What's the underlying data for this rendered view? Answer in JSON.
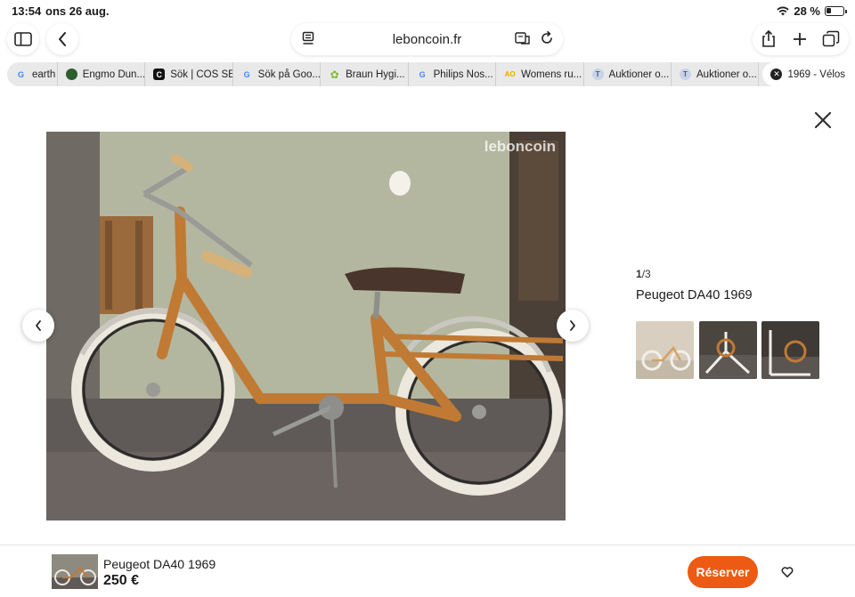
{
  "status": {
    "time": "13:54",
    "date": "ons 26 aug.",
    "battery": "28 %",
    "battery_level": 0.28
  },
  "toolbar": {
    "url": "leboncoin.fr"
  },
  "tabs": [
    {
      "label": "earth",
      "icon": "google-icon"
    },
    {
      "label": "Engmo Dun...",
      "icon": "globe-icon"
    },
    {
      "label": "Sök | COS SE",
      "icon": "cos-icon"
    },
    {
      "label": "Sök på Goo...",
      "icon": "google-icon"
    },
    {
      "label": "Braun Hygi...",
      "icon": "leaf-icon"
    },
    {
      "label": "Philips Nos...",
      "icon": "google-icon"
    },
    {
      "label": "Womens ru...",
      "icon": "ao-icon"
    },
    {
      "label": "Auktioner o...",
      "icon": "auction-icon"
    },
    {
      "label": "Auktioner o...",
      "icon": "auction-icon"
    },
    {
      "label": "1969 - Vélos",
      "icon": "close-tab-icon"
    }
  ],
  "gallery": {
    "watermark": "leboncoin",
    "counter_current": "1",
    "counter_total": "/3",
    "title": "Peugeot DA40 1969"
  },
  "bottom_bar": {
    "title": "Peugeot DA40 1969",
    "price": "250 €",
    "reserve_label": "Réserver"
  },
  "colors": {
    "accent": "#ec5a13",
    "bike_frame": "#c07a34"
  }
}
